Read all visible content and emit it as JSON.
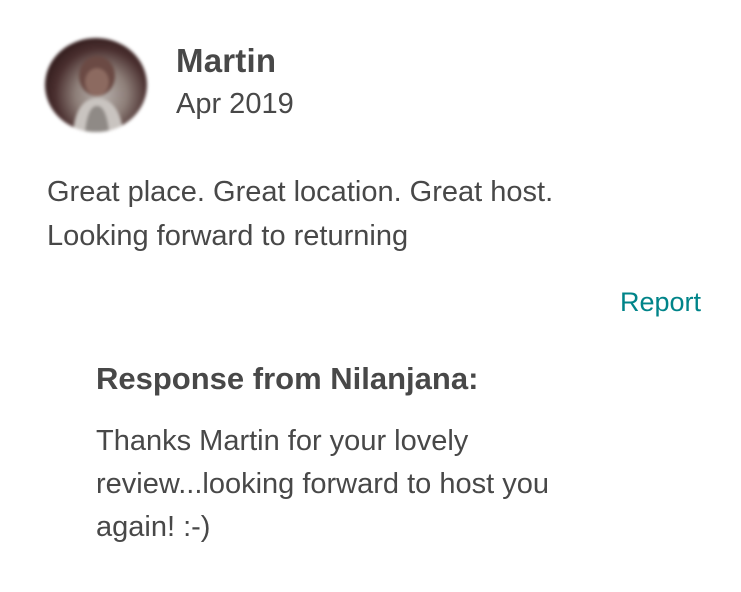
{
  "review": {
    "reviewer_name": "Martin",
    "date": "Apr 2019",
    "text_line1": "Great place. Great location. Great host.",
    "text_line2": "Looking forward to returning",
    "report_label": "Report"
  },
  "response": {
    "title": "Response from Nilanjana:",
    "text_line1": "Thanks Martin for your lovely",
    "text_line2": "review...looking forward to host you",
    "text_line3": "again! :-)"
  },
  "colors": {
    "text": "#484848",
    "link": "#008489",
    "background": "#ffffff"
  },
  "icons": {
    "avatar": "reviewer-avatar-photo"
  }
}
